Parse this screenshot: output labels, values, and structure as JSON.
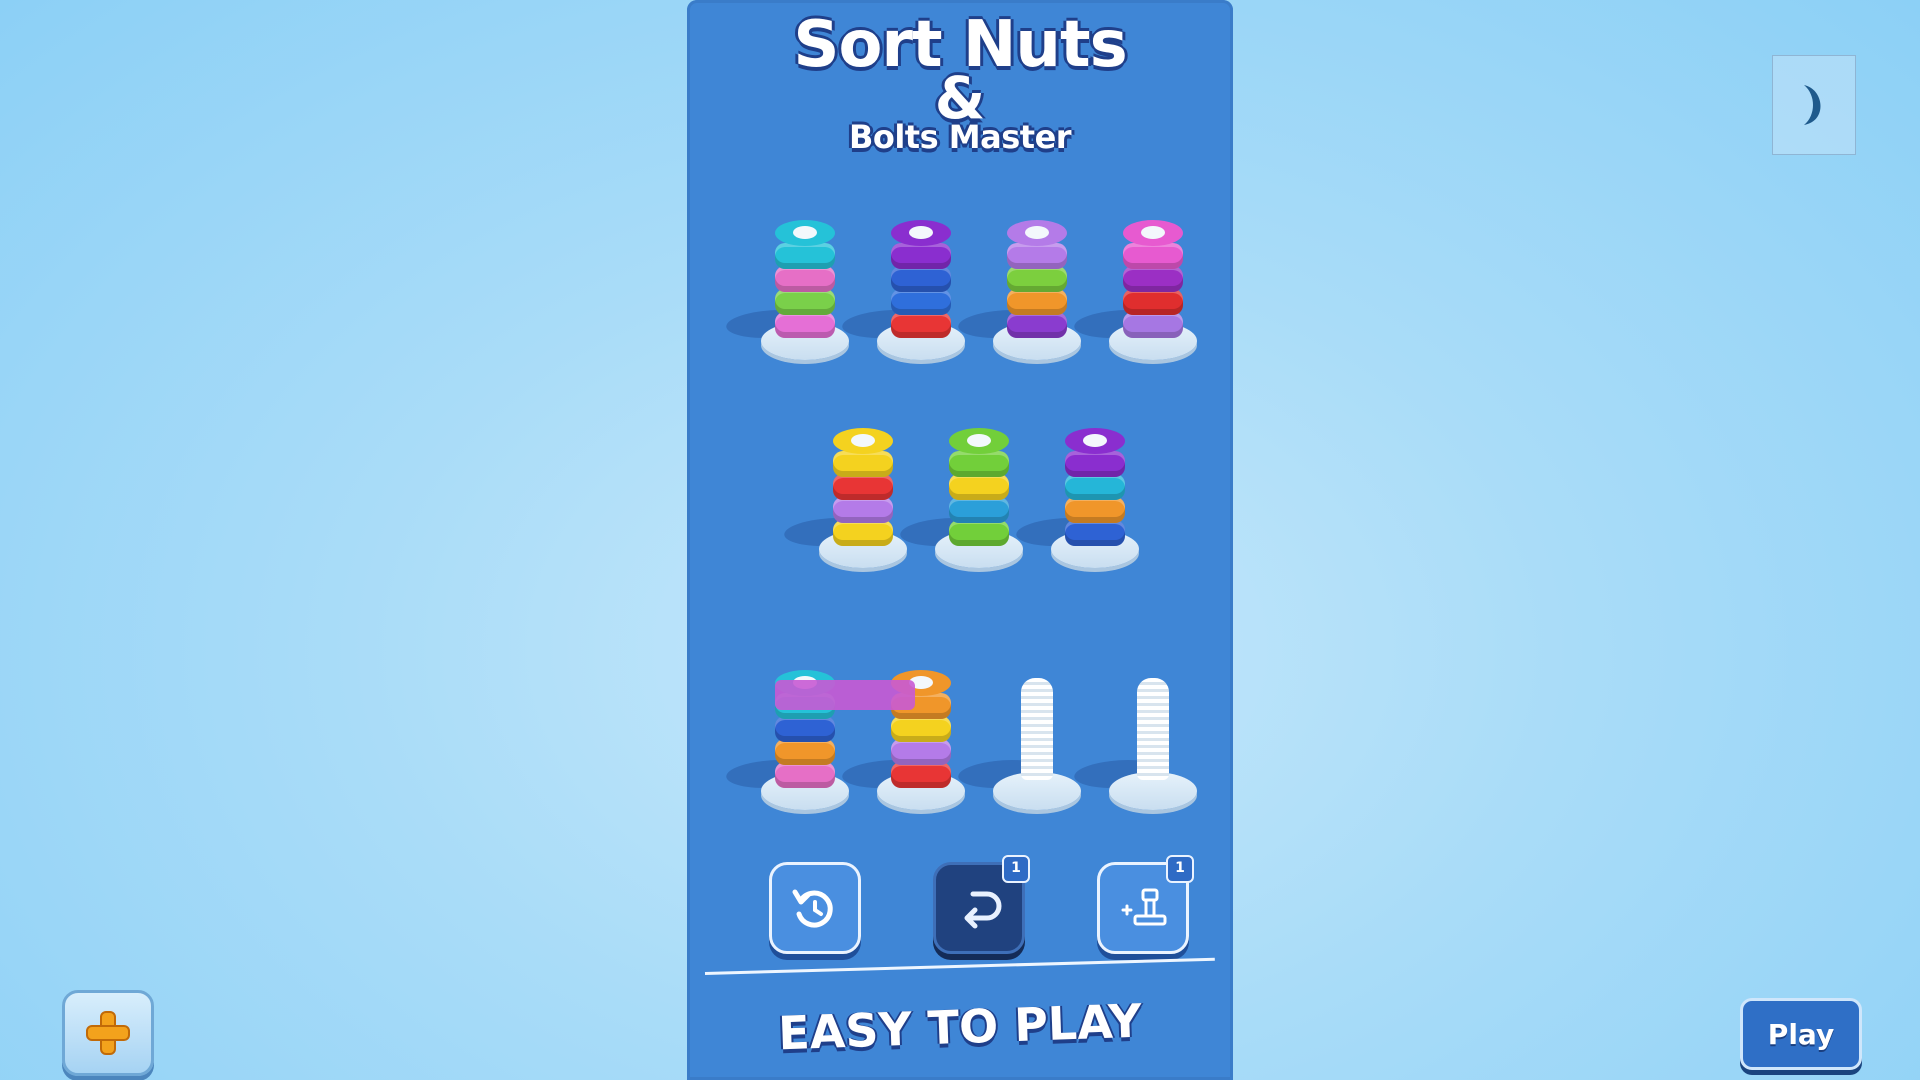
{
  "game": {
    "title_line1": "Sort Nuts",
    "title_line2": "&",
    "title_line3": "Bolts Master",
    "tagline": "EASY TO PLAY"
  },
  "board": {
    "rows": [
      [
        {
          "nuts": [
            "#e56fd6",
            "#7ad04a",
            "#e66fc6",
            "#25c2d8"
          ]
        },
        {
          "nuts": [
            "#e83535",
            "#2f6fdc",
            "#2e62d4",
            "#8a2ecf"
          ]
        },
        {
          "nuts": [
            "#8a3ccf",
            "#f0962a",
            "#7ccf3e",
            "#b47be8"
          ]
        },
        {
          "nuts": [
            "#a677e3",
            "#e02e2e",
            "#9b2fc4",
            "#e75ad0"
          ]
        }
      ],
      [
        {
          "nuts": [
            "#f4d21f",
            "#b47be8",
            "#e83535",
            "#f4d21f"
          ]
        },
        {
          "nuts": [
            "#72cf3a",
            "#2b9fd9",
            "#f4d21f",
            "#72cf3a"
          ]
        },
        {
          "nuts": [
            "#2e62d4",
            "#f0962a",
            "#25b6d8",
            "#8a2ecf"
          ]
        }
      ],
      [
        {
          "nuts": [
            "#e66fc6",
            "#f0962a",
            "#2e62d4",
            "#25c2d8"
          ]
        },
        {
          "nuts": [
            "#e83535",
            "#b47be8",
            "#f4d21f",
            "#f0962a"
          ]
        },
        {
          "nuts": []
        },
        {
          "nuts": []
        }
      ]
    ]
  },
  "tools": {
    "restart_badge": "",
    "undo_badge": "1",
    "add_bolt_badge": "1"
  },
  "controls": {
    "play_label": "Play"
  },
  "colors": {
    "panel": "#3f86d6",
    "background": "#a9dcf8",
    "title_outline": "#1f3f8a"
  }
}
